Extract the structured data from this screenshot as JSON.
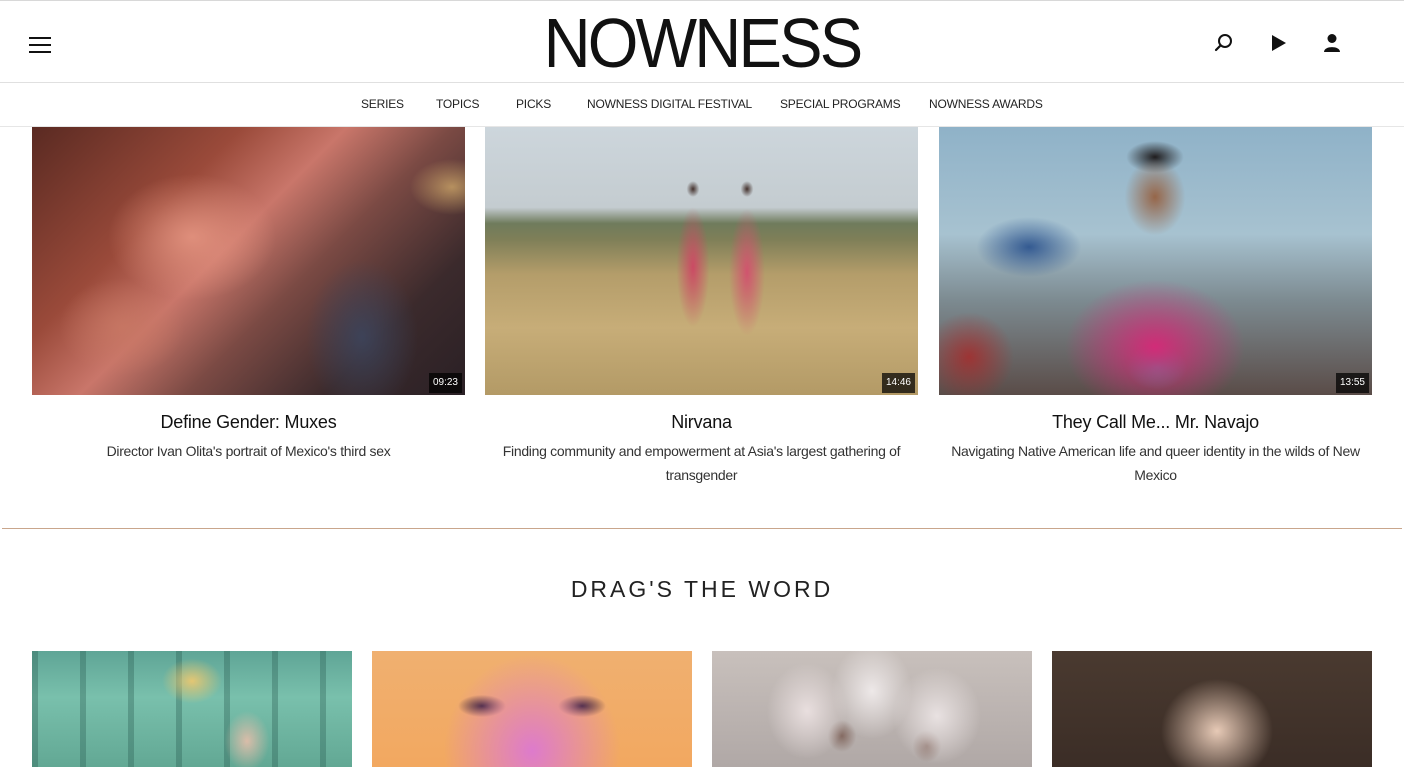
{
  "header": {
    "logo": "NOWNESS",
    "icons": [
      "menu-icon",
      "search-icon",
      "play-icon",
      "user-icon"
    ]
  },
  "nav": {
    "items": [
      "SERIES",
      "TOPICS",
      "PICKS",
      "NOWNESS DIGITAL FESTIVAL",
      "SPECIAL PROGRAMS",
      "NOWNESS AWARDS"
    ]
  },
  "cards": [
    {
      "title": "Define Gender: Muxes",
      "description": "Director Ivan Olita's portrait of Mexico's third sex",
      "duration": "09:23"
    },
    {
      "title": "Nirvana",
      "description": "Finding community and empowerment at Asia's largest gathering of transgender",
      "duration": "14:46"
    },
    {
      "title": "They Call Me... Mr. Navajo",
      "description": "Navigating Native American life and queer identity in the wilds of New Mexico",
      "duration": "13:55"
    }
  ],
  "section": {
    "title": "DRAG'S THE WORD"
  },
  "colors": {
    "divider": "#c9a68c",
    "text": "#111111"
  }
}
